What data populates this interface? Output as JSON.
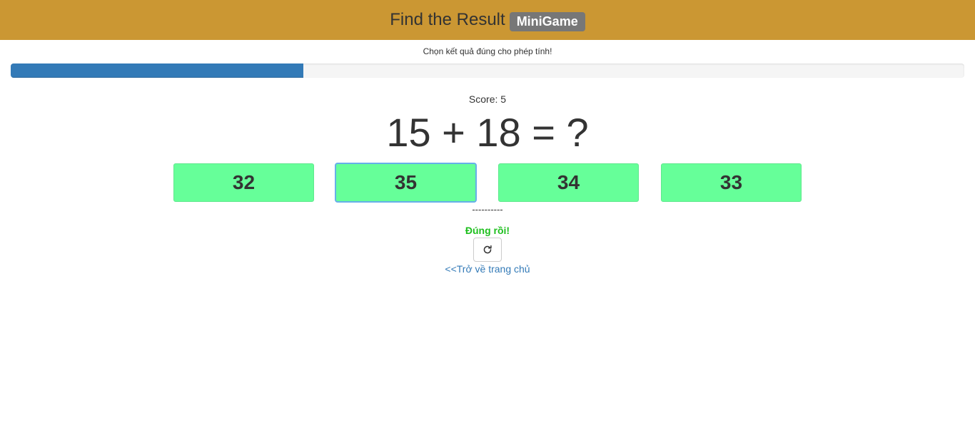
{
  "header": {
    "title": "Find the Result",
    "badge": "MiniGame",
    "background_color": "#cb9733"
  },
  "instruction": "Chọn kết quả đúng cho phép tính!",
  "progress": {
    "fraction": 0.307,
    "color": "#337ab7"
  },
  "score": {
    "text": "Score: 5",
    "value": 5
  },
  "question": {
    "equation": "15 + 18 = ?"
  },
  "answers": [
    {
      "label": "32"
    },
    {
      "label": "35",
      "focused": true
    },
    {
      "label": "34"
    },
    {
      "label": "33"
    }
  ],
  "answer_color": "#66ff99",
  "divider": "----------",
  "result": {
    "text": "Đúng rồi!",
    "color": "#1fbf1f"
  },
  "reload_button": {
    "icon": "reload-icon"
  },
  "back_link": {
    "text": "<<Trở về trang chủ"
  }
}
